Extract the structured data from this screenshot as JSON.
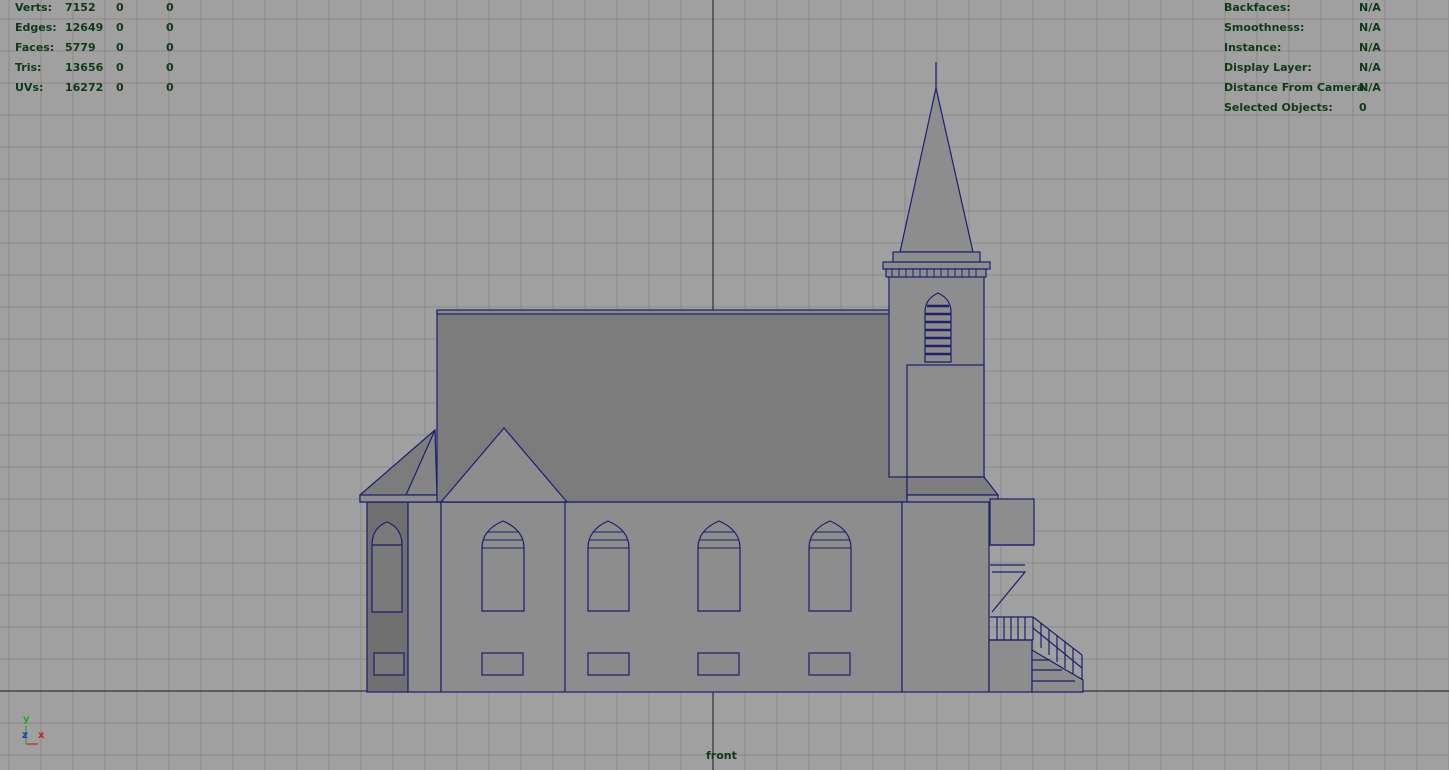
{
  "window": {
    "title": "front"
  },
  "stats": [
    {
      "label": "Verts:",
      "values": [
        "7152",
        "0",
        "0"
      ]
    },
    {
      "label": "Edges:",
      "values": [
        "12649",
        "0",
        "0"
      ]
    },
    {
      "label": "Faces:",
      "values": [
        "5779",
        "0",
        "0"
      ]
    },
    {
      "label": "Tris:",
      "values": [
        "13656",
        "0",
        "0"
      ]
    },
    {
      "label": "UVs:",
      "values": [
        "16272",
        "0",
        "0"
      ]
    }
  ],
  "info": [
    {
      "label": "Backfaces:",
      "value": "N/A"
    },
    {
      "label": "Smoothness:",
      "value": "N/A"
    },
    {
      "label": "Instance:",
      "value": "N/A"
    },
    {
      "label": "Display Layer:",
      "value": "N/A"
    },
    {
      "label": "Distance From Camera:",
      "value": "N/A"
    },
    {
      "label": "Selected Objects:",
      "value": "0"
    }
  ],
  "axis_labels": {
    "y": "y",
    "z": "z",
    "x": "x"
  },
  "colors": {
    "viewport_bg": "#a0a0a0",
    "grid": "#8a8a8a",
    "axis": "#303030",
    "model_fill": "#8d8d8d",
    "roof_fill": "#7a7a7a",
    "wireframe": "#1c1e6e",
    "hud_text": "#0e3a18"
  }
}
